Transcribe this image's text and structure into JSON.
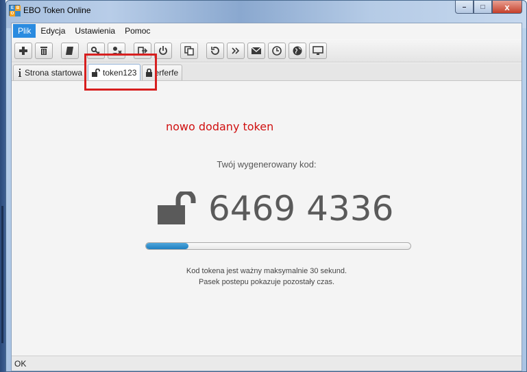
{
  "window": {
    "title": "EBO Token Online",
    "controls": {
      "minimize": "–",
      "maximize": "□",
      "close": "x"
    }
  },
  "menu": {
    "items": [
      "Plik",
      "Edycja",
      "Ustawienia",
      "Pomoc"
    ],
    "active_index": 0
  },
  "toolbar": {
    "buttons": [
      {
        "name": "add-icon"
      },
      {
        "name": "trash-icon"
      },
      {
        "name": "notebook-icon"
      },
      {
        "name": "key-icon"
      },
      {
        "name": "user-remove-icon"
      },
      {
        "name": "logout-icon"
      },
      {
        "name": "power-icon"
      },
      {
        "name": "copy-icon"
      },
      {
        "name": "history-icon"
      },
      {
        "name": "forward-icon"
      },
      {
        "name": "mail-icon"
      },
      {
        "name": "clock-icon"
      },
      {
        "name": "globe-icon"
      },
      {
        "name": "monitor-icon"
      }
    ]
  },
  "tabs": [
    {
      "label": "Strona startowa",
      "icon": "info-icon"
    },
    {
      "label": "token123",
      "icon": "unlock-icon",
      "selected": true
    },
    {
      "label": "erferfe",
      "icon": "lock-icon"
    }
  ],
  "content": {
    "annotation": "nowo dodany token",
    "code_label": "Twój wygenerowany kod:",
    "code": "6469 4336",
    "progress": 0.16,
    "info_line1": "Kod tokena jest ważny maksymalnie 30 sekund.",
    "info_line2": "Pasek postepu pokazuje pozostały czas."
  },
  "statusbar": {
    "text": "OK"
  },
  "colors": {
    "accent": "#2a8be0",
    "annotation": "#d01010",
    "highlight": "#d71f1f",
    "progress": "#1f7fc0"
  }
}
